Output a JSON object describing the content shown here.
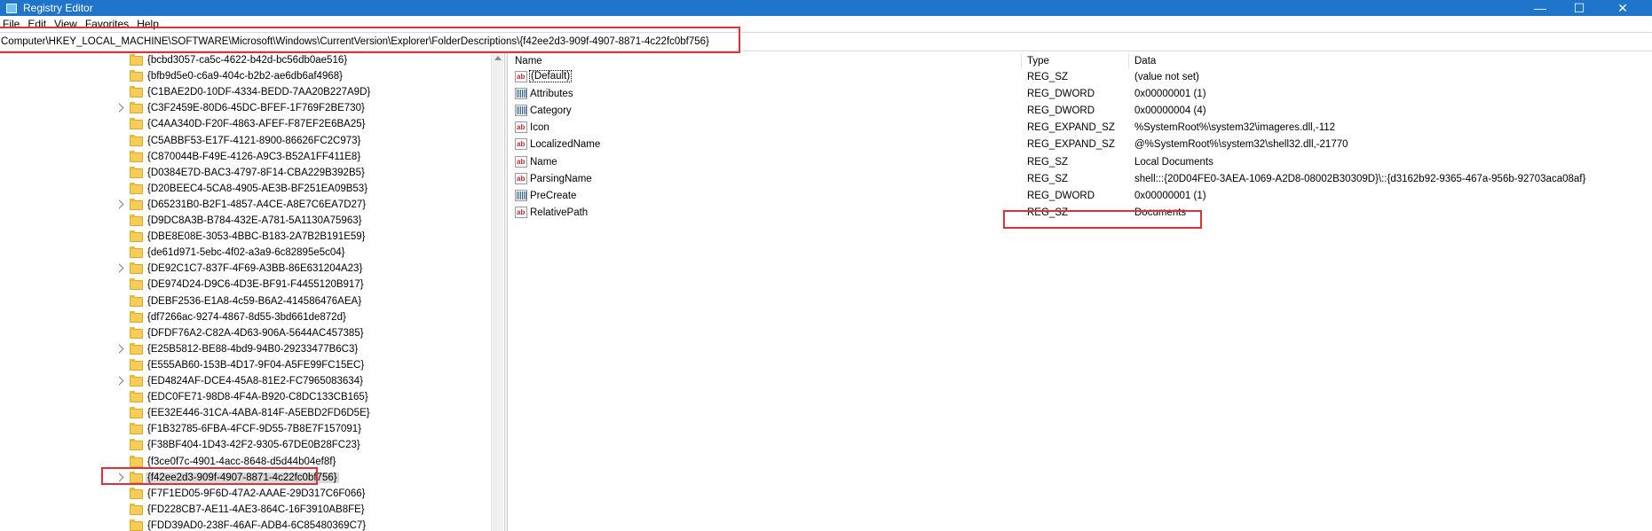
{
  "window": {
    "title": "Registry Editor",
    "controls": {
      "minimize": "—",
      "maximize": "☐",
      "close": "✕"
    }
  },
  "menu": [
    "File",
    "Edit",
    "View",
    "Favorites",
    "Help"
  ],
  "address": "Computer\\HKEY_LOCAL_MACHINE\\SOFTWARE\\Microsoft\\Windows\\CurrentVersion\\Explorer\\FolderDescriptions\\{f42ee2d3-909f-4907-8871-4c22fc0bf756}",
  "tree": {
    "items": [
      {
        "label": "{bcbd3057-ca5c-4622-b42d-bc56db0ae516}",
        "expandable": false,
        "selected": false
      },
      {
        "label": "{bfb9d5e0-c6a9-404c-b2b2-ae6db6af4968}",
        "expandable": false,
        "selected": false
      },
      {
        "label": "{C1BAE2D0-10DF-4334-BEDD-7AA20B227A9D}",
        "expandable": false,
        "selected": false
      },
      {
        "label": "{C3F2459E-80D6-45DC-BFEF-1F769F2BE730}",
        "expandable": true,
        "selected": false
      },
      {
        "label": "{C4AA340D-F20F-4863-AFEF-F87EF2E6BA25}",
        "expandable": false,
        "selected": false
      },
      {
        "label": "{C5ABBF53-E17F-4121-8900-86626FC2C973}",
        "expandable": false,
        "selected": false
      },
      {
        "label": "{C870044B-F49E-4126-A9C3-B52A1FF411E8}",
        "expandable": false,
        "selected": false
      },
      {
        "label": "{D0384E7D-BAC3-4797-8F14-CBA229B392B5}",
        "expandable": false,
        "selected": false
      },
      {
        "label": "{D20BEEC4-5CA8-4905-AE3B-BF251EA09B53}",
        "expandable": false,
        "selected": false
      },
      {
        "label": "{D65231B0-B2F1-4857-A4CE-A8E7C6EA7D27}",
        "expandable": true,
        "selected": false
      },
      {
        "label": "{D9DC8A3B-B784-432E-A781-5A1130A75963}",
        "expandable": false,
        "selected": false
      },
      {
        "label": "{DBE8E08E-3053-4BBC-B183-2A7B2B191E59}",
        "expandable": false,
        "selected": false
      },
      {
        "label": "{de61d971-5ebc-4f02-a3a9-6c82895e5c04}",
        "expandable": false,
        "selected": false
      },
      {
        "label": "{DE92C1C7-837F-4F69-A3BB-86E631204A23}",
        "expandable": true,
        "selected": false
      },
      {
        "label": "{DE974D24-D9C6-4D3E-BF91-F4455120B917}",
        "expandable": false,
        "selected": false
      },
      {
        "label": "{DEBF2536-E1A8-4c59-B6A2-414586476AEA}",
        "expandable": false,
        "selected": false
      },
      {
        "label": "{df7266ac-9274-4867-8d55-3bd661de872d}",
        "expandable": false,
        "selected": false
      },
      {
        "label": "{DFDF76A2-C82A-4D63-906A-5644AC457385}",
        "expandable": false,
        "selected": false
      },
      {
        "label": "{E25B5812-BE88-4bd9-94B0-29233477B6C3}",
        "expandable": true,
        "selected": false
      },
      {
        "label": "{E555AB60-153B-4D17-9F04-A5FE99FC15EC}",
        "expandable": false,
        "selected": false
      },
      {
        "label": "{ED4824AF-DCE4-45A8-81E2-FC7965083634}",
        "expandable": true,
        "selected": false
      },
      {
        "label": "{EDC0FE71-98D8-4F4A-B920-C8DC133CB165}",
        "expandable": false,
        "selected": false
      },
      {
        "label": "{EE32E446-31CA-4ABA-814F-A5EBD2FD6D5E}",
        "expandable": false,
        "selected": false
      },
      {
        "label": "{F1B32785-6FBA-4FCF-9D55-7B8E7F157091}",
        "expandable": false,
        "selected": false
      },
      {
        "label": "{F38BF404-1D43-42F2-9305-67DE0B28FC23}",
        "expandable": false,
        "selected": false
      },
      {
        "label": "{f3ce0f7c-4901-4acc-8648-d5d44b04ef8f}",
        "expandable": false,
        "selected": false
      },
      {
        "label": "{f42ee2d3-909f-4907-8871-4c22fc0bf756}",
        "expandable": true,
        "selected": true
      },
      {
        "label": "{F7F1ED05-9F6D-47A2-AAAE-29D317C6F066}",
        "expandable": false,
        "selected": false
      },
      {
        "label": "{FD228CB7-AE11-4AE3-864C-16F3910AB8FE}",
        "expandable": false,
        "selected": false
      },
      {
        "label": "{FDD39AD0-238F-46AF-ADB4-6C85480369C7}",
        "expandable": false,
        "selected": false
      }
    ]
  },
  "values": {
    "headers": {
      "name": "Name",
      "type": "Type",
      "data": "Data"
    },
    "rows": [
      {
        "icon": "string-value-icon",
        "glyph": "ab",
        "name": "(Default)",
        "type": "REG_SZ",
        "data": "(value not set)"
      },
      {
        "icon": "binary-value-icon",
        "glyph": "",
        "name": "Attributes",
        "type": "REG_DWORD",
        "data": "0x00000001 (1)"
      },
      {
        "icon": "binary-value-icon",
        "glyph": "",
        "name": "Category",
        "type": "REG_DWORD",
        "data": "0x00000004 (4)"
      },
      {
        "icon": "string-value-icon",
        "glyph": "ab",
        "name": "Icon",
        "type": "REG_EXPAND_SZ",
        "data": "%SystemRoot%\\system32\\imageres.dll,-112"
      },
      {
        "icon": "string-value-icon",
        "glyph": "ab",
        "name": "LocalizedName",
        "type": "REG_EXPAND_SZ",
        "data": "@%SystemRoot%\\system32\\shell32.dll,-21770"
      },
      {
        "icon": "string-value-icon",
        "glyph": "ab",
        "name": "Name",
        "type": "REG_SZ",
        "data": "Local Documents"
      },
      {
        "icon": "string-value-icon",
        "glyph": "ab",
        "name": "ParsingName",
        "type": "REG_SZ",
        "data": "shell:::{20D04FE0-3AEA-1069-A2D8-08002B30309D}\\::{d3162b92-9365-467a-956b-92703aca08af}"
      },
      {
        "icon": "binary-value-icon",
        "glyph": "",
        "name": "PreCreate",
        "type": "REG_DWORD",
        "data": "0x00000001 (1)"
      },
      {
        "icon": "string-value-icon",
        "glyph": "ab",
        "name": "RelativePath",
        "type": "REG_SZ",
        "data": "Documents"
      }
    ]
  },
  "colors": {
    "titlebar": "#1f75c9",
    "highlight_box": "#e0303a",
    "folder": "#f5cd57"
  }
}
